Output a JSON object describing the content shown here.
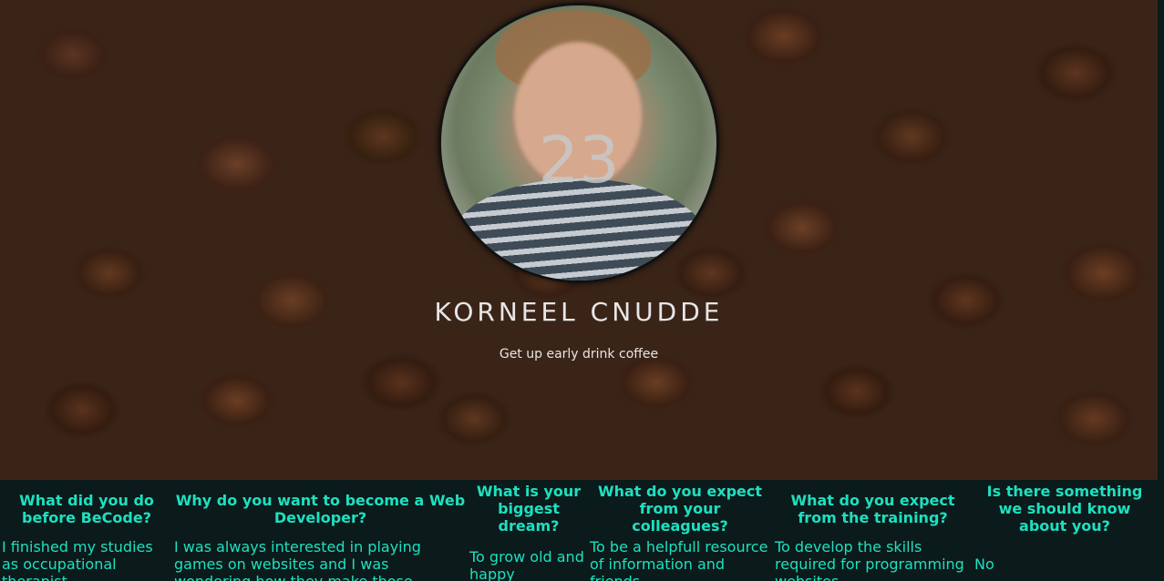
{
  "profile": {
    "age": "23",
    "name": "KORNEEL CNUDDE",
    "tagline": "Get up early drink coffee"
  },
  "qa": [
    {
      "question": "What did you do before BeCode?",
      "answer": "I finished my studies as occupational therapist"
    },
    {
      "question": "Why do you want to become a Web Developer?",
      "answer": "I was always interested in playing games on websites and I was wondering how they make those sites"
    },
    {
      "question": "What is your biggest dream?",
      "answer": "To grow old and happy"
    },
    {
      "question": "What do you expect from your colleagues?",
      "answer": "To be a helpfull resource of information and friends"
    },
    {
      "question": "What do you expect from the training?",
      "answer": "To develop the skills required for programming websites"
    },
    {
      "question": "Is there something we should know about you?",
      "answer": "No"
    }
  ]
}
